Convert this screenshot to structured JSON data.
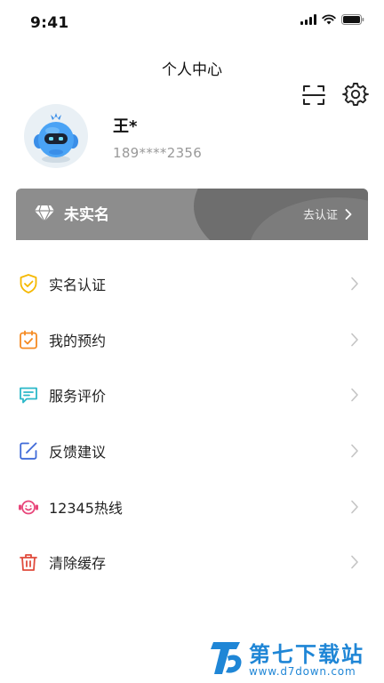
{
  "status_bar": {
    "time": "9:41"
  },
  "header": {
    "title": "个人中心"
  },
  "profile": {
    "name": "王*",
    "phone": "189****2356"
  },
  "verify_card": {
    "status": "未实名",
    "action": "去认证"
  },
  "menu": {
    "items": [
      {
        "label": "实名认证",
        "icon": "shield-check-icon",
        "color": "#f5b800"
      },
      {
        "label": "我的预约",
        "icon": "calendar-check-icon",
        "color": "#f58a22"
      },
      {
        "label": "服务评价",
        "icon": "comment-icon",
        "color": "#2bb8c8"
      },
      {
        "label": "反馈建议",
        "icon": "edit-icon",
        "color": "#3f6ad8"
      },
      {
        "label": "12345热线",
        "icon": "hotline-icon",
        "color": "#e8457a"
      },
      {
        "label": "清除缓存",
        "icon": "trash-icon",
        "color": "#e04b3c"
      }
    ]
  },
  "watermark": {
    "name": "第七下载站",
    "url": "www.d7down.com"
  }
}
